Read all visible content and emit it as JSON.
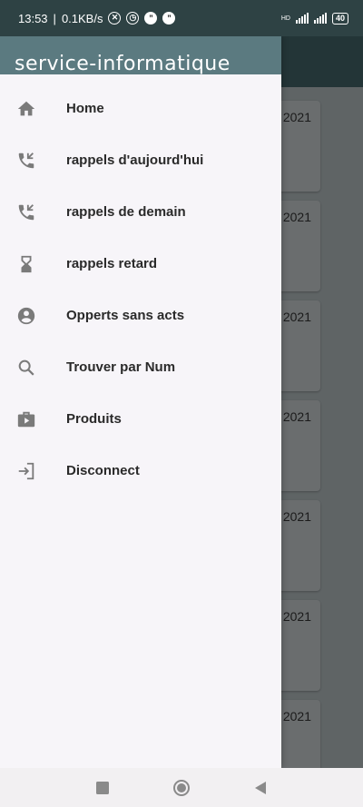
{
  "status_bar": {
    "time": "13:53",
    "speed": "0.1KB/s",
    "battery": "40",
    "net_label": "HD"
  },
  "drawer": {
    "header_title": "service-informatique",
    "items": [
      {
        "label": "Home",
        "icon": "home-icon"
      },
      {
        "label": "rappels d'aujourd'hui",
        "icon": "phone-callback-icon"
      },
      {
        "label": "rappels de demain",
        "icon": "phone-callback-icon"
      },
      {
        "label": "rappels retard",
        "icon": "hourglass-icon"
      },
      {
        "label": "Opperts sans acts",
        "icon": "account-circle-icon"
      },
      {
        "label": "Trouver par Num",
        "icon": "search-icon"
      },
      {
        "label": "Produits",
        "icon": "product-box-icon"
      },
      {
        "label": "Disconnect",
        "icon": "logout-icon"
      }
    ]
  },
  "background_cards": [
    {
      "date": "2021"
    },
    {
      "date": "2021"
    },
    {
      "date": "2021"
    },
    {
      "date": "2021"
    },
    {
      "date": "2021"
    },
    {
      "date": "2021"
    },
    {
      "date": "2021"
    }
  ],
  "colors": {
    "header": "#5b7a80",
    "drawer_bg": "#f7f5f9",
    "icon": "#7a7a7a",
    "status_bar": "#2e4244"
  }
}
